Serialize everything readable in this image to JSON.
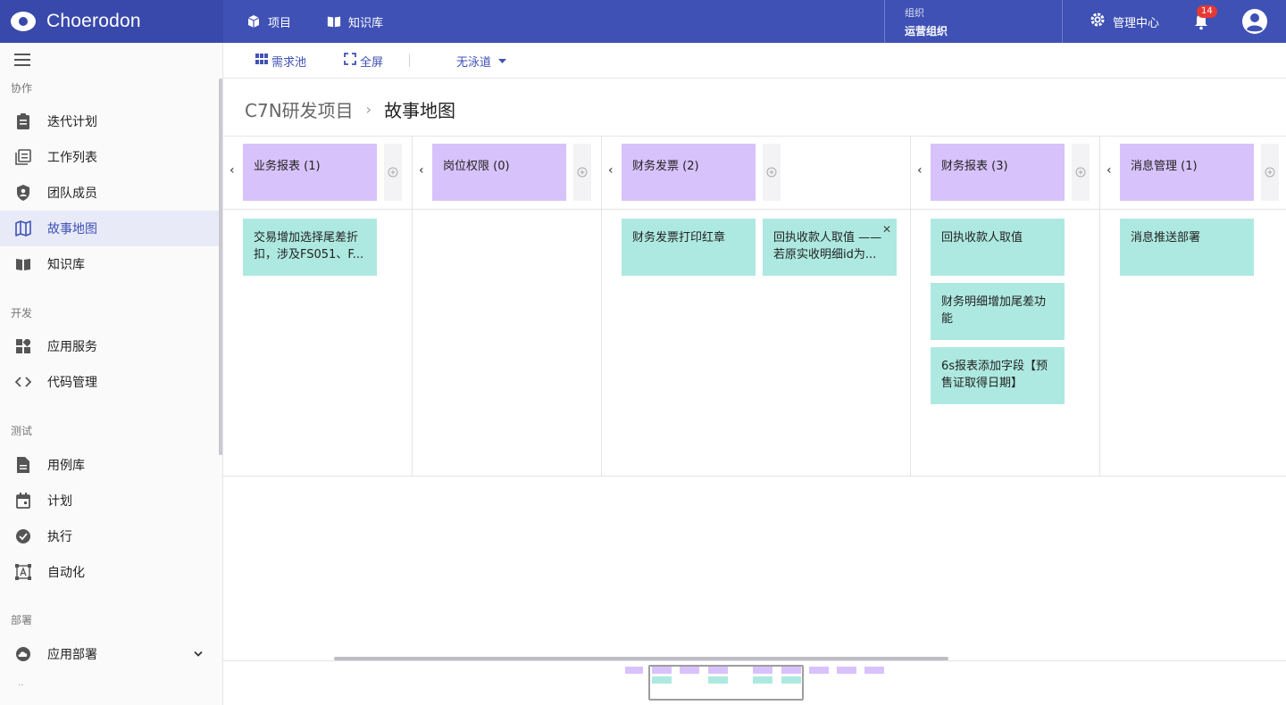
{
  "header": {
    "brand": "Choerodon",
    "nav": [
      {
        "label": "项目",
        "icon": "cube-icon"
      },
      {
        "label": "知识库",
        "icon": "book-icon"
      }
    ],
    "org_label": "组织",
    "org_name": "运营组织",
    "admin_label": "管理中心",
    "notification_count": "14",
    "accent": "#3f51b5",
    "brand_bg": "#3949ab"
  },
  "sidebar": {
    "groups": [
      {
        "title": "协作",
        "items": [
          {
            "label": "迭代计划",
            "icon": "clipboard-icon"
          },
          {
            "label": "工作列表",
            "icon": "list-icon"
          },
          {
            "label": "团队成员",
            "icon": "shield-user-icon"
          },
          {
            "label": "故事地图",
            "icon": "map-icon",
            "active": true
          },
          {
            "label": "知识库",
            "icon": "book-icon"
          }
        ]
      },
      {
        "title": "开发",
        "items": [
          {
            "label": "应用服务",
            "icon": "apps-icon"
          },
          {
            "label": "代码管理",
            "icon": "code-icon"
          }
        ]
      },
      {
        "title": "测试",
        "items": [
          {
            "label": "用例库",
            "icon": "document-icon"
          },
          {
            "label": "计划",
            "icon": "calendar-icon"
          },
          {
            "label": "执行",
            "icon": "check-circle-icon"
          },
          {
            "label": "自动化",
            "icon": "automation-icon"
          }
        ]
      },
      {
        "title": "部署",
        "items": [
          {
            "label": "应用部署",
            "icon": "cloud-icon"
          }
        ]
      }
    ],
    "more": ".."
  },
  "toolbar": {
    "backlog": "需求池",
    "fullscreen": "全屏",
    "swimlane": "无泳道"
  },
  "breadcrumb": {
    "parent": "C7N研发项目",
    "current": "故事地图"
  },
  "epics": [
    {
      "title": "业务报表",
      "count": "(1)",
      "stories": [
        "交易增加选择尾差折扣，涉及FS051、F..."
      ]
    },
    {
      "title": "岗位权限",
      "count": "(0)",
      "stories": []
    },
    {
      "title": "财务发票",
      "count": "(2)",
      "stories": [
        "财务发票打印红章",
        "回执收款人取值 —— 若原实收明细id为..."
      ]
    },
    {
      "title": "财务报表",
      "count": "(3)",
      "stories": [
        "回执收款人取值",
        "财务明细增加尾差功能",
        "6s报表添加字段【预售证取得日期】"
      ]
    },
    {
      "title": "消息管理",
      "count": "(1)",
      "stories": [
        "消息推送部署"
      ]
    }
  ],
  "colors": {
    "epic": "#d8c2fb",
    "story": "#ade9e0"
  }
}
